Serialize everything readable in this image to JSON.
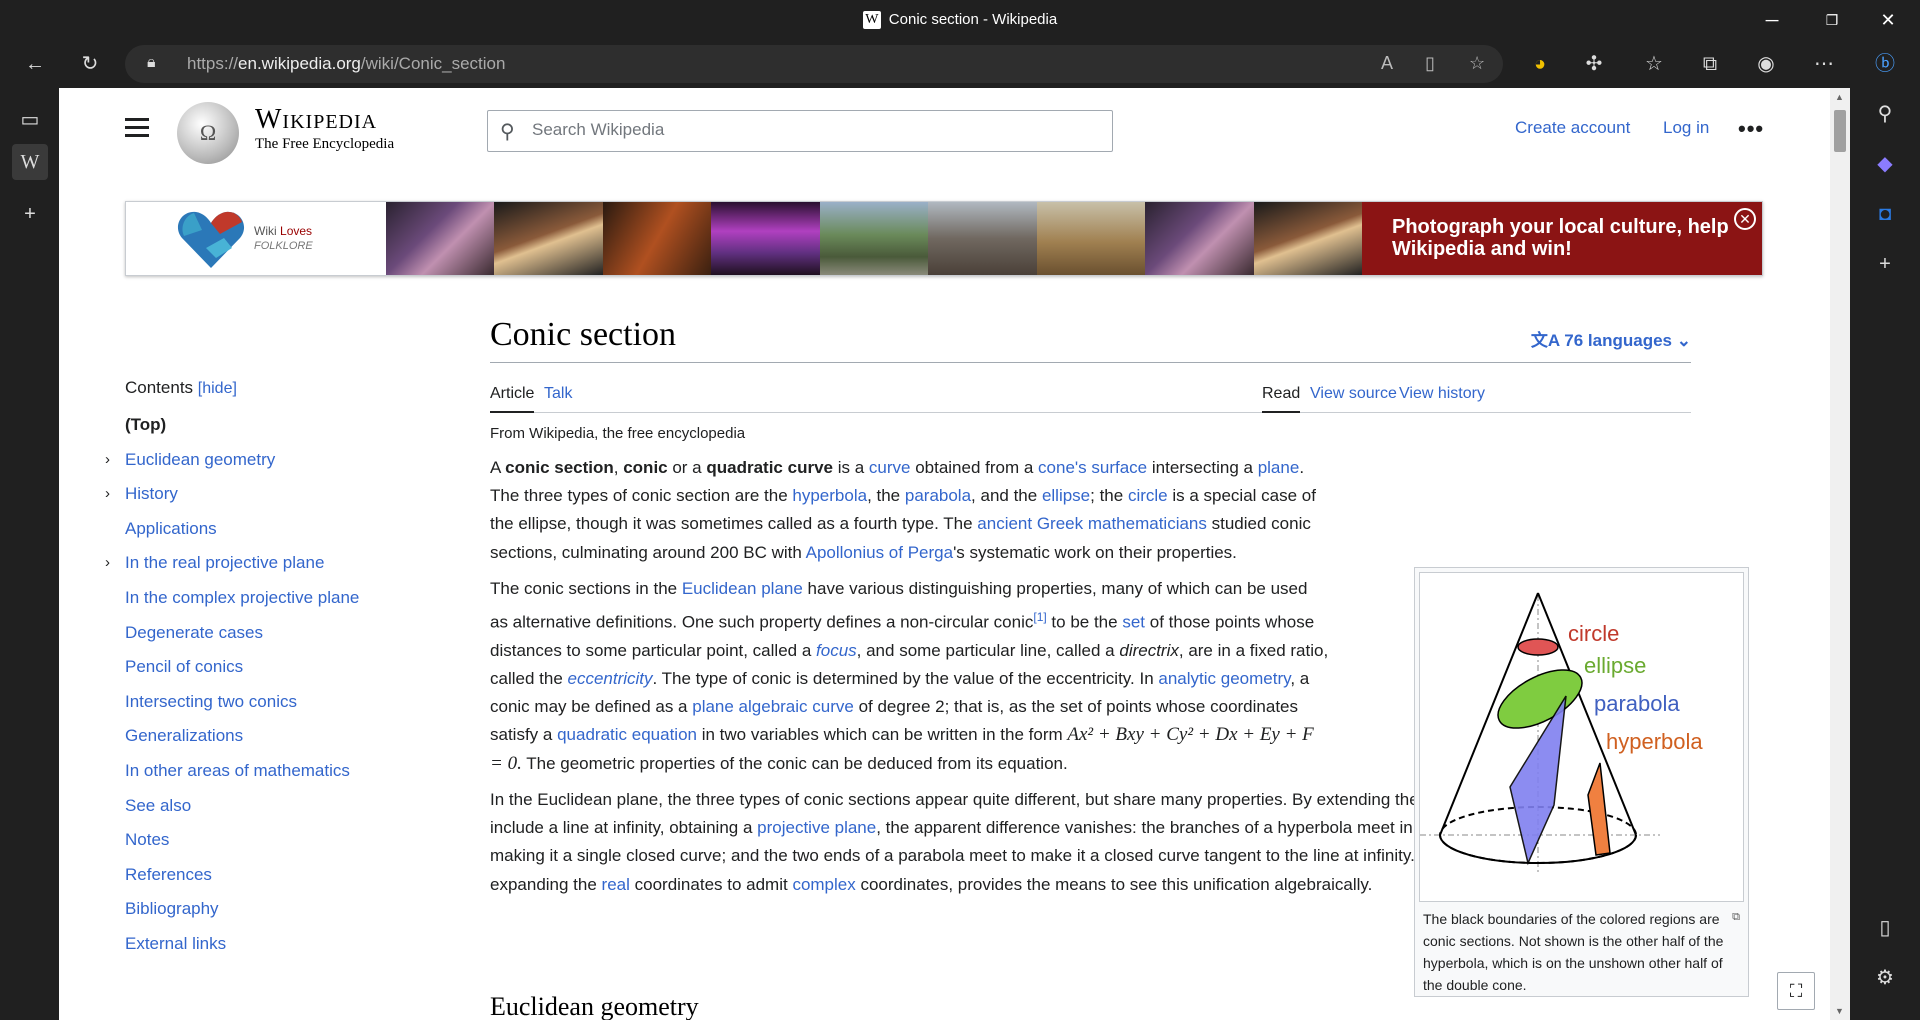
{
  "window": {
    "title": "Conic section - Wikipedia",
    "tab_icon": "W"
  },
  "address": {
    "scheme": "https://",
    "host": "en.wikipedia.org",
    "path": "/wiki/Conic_section"
  },
  "header": {
    "wordmark": "Wikipedia",
    "tagline": "The Free Encyclopedia",
    "search_placeholder": "Search Wikipedia",
    "create_account": "Create account",
    "log_in": "Log in",
    "more": "•••"
  },
  "banner": {
    "logo_text_1": "Wiki",
    "logo_text_2": "Loves",
    "logo_text_3": "FOLKLORE",
    "cta": "Photograph your local culture, help Wikipedia and win!",
    "close": "✕"
  },
  "toc": {
    "title": "Contents",
    "hide": "[hide]",
    "items": [
      {
        "label": "(Top)",
        "chevron": false
      },
      {
        "label": "Euclidean geometry",
        "chevron": true
      },
      {
        "label": "History",
        "chevron": true
      },
      {
        "label": "Applications",
        "chevron": false
      },
      {
        "label": "In the real projective plane",
        "chevron": true
      },
      {
        "label": "In the complex projective plane",
        "chevron": false
      },
      {
        "label": "Degenerate cases",
        "chevron": false
      },
      {
        "label": "Pencil of conics",
        "chevron": false
      },
      {
        "label": "Intersecting two conics",
        "chevron": false
      },
      {
        "label": "Generalizations",
        "chevron": false
      },
      {
        "label": "In other areas of mathematics",
        "chevron": false
      },
      {
        "label": "See also",
        "chevron": false
      },
      {
        "label": "Notes",
        "chevron": false
      },
      {
        "label": "References",
        "chevron": false
      },
      {
        "label": "Bibliography",
        "chevron": false
      },
      {
        "label": "External links",
        "chevron": false
      }
    ]
  },
  "article": {
    "title": "Conic section",
    "languages": "76 languages",
    "tabs": {
      "article": "Article",
      "talk": "Talk",
      "read": "Read",
      "view_source": "View source",
      "view_history": "View history"
    },
    "from": "From Wikipedia, the free encyclopedia",
    "p1": {
      "t1": "A ",
      "b1": "conic section",
      "t2": ", ",
      "b2": "conic",
      "t3": " or a ",
      "b3": "quadratic curve",
      "t4": " is a ",
      "l1": "curve",
      "t5": " obtained from a ",
      "l2": "cone's surface",
      "t6": " intersecting a ",
      "l3": "plane",
      "t7": ". The three types of conic section are the ",
      "l4": "hyperbola",
      "t8": ", the ",
      "l5": "parabola",
      "t9": ", and the ",
      "l6": "ellipse",
      "t10": "; the ",
      "l7": "circle",
      "t11": " is a special case of the ellipse, though it was sometimes called as a fourth type. The ",
      "l8": "ancient Greek mathematicians",
      "t12": " studied conic sections, culminating around 200 BC with ",
      "l9": "Apollonius of Perga",
      "t13": "'s systematic work on their properties."
    },
    "p2": {
      "t1": "The conic sections in the ",
      "l1": "Euclidean plane",
      "t2": " have various distinguishing properties, many of which can be used as alternative definitions. One such property defines a non-circular conic",
      "ref": "[1]",
      "t3": " to be the ",
      "l2": "set",
      "t4": " of those points whose distances to some particular point, called a ",
      "l3": "focus",
      "t5": ", and some particular line, called a ",
      "i1": "directrix",
      "t6": ", are in a fixed ratio, called the ",
      "l4": "eccentricity",
      "t7": ". The type of conic is determined by the value of the eccentricity. In ",
      "l5": "analytic geometry",
      "t8": ", a conic may be defined as a ",
      "l6": "plane algebraic curve",
      "t9": " of degree 2; that is, as the set of points whose coordinates satisfy a ",
      "l7": "quadratic equation",
      "t10": " in two variables which can be written in the form ",
      "eq": "Ax² + Bxy + Cy² + Dx + Ey + F = 0.",
      "t11": " The geometric properties of the conic can be deduced from its equation."
    },
    "p3": {
      "t1": "In the Euclidean plane, the three types of conic sections appear quite different, but share many properties. By extending the Euclidean plane to include a line at infinity, obtaining a ",
      "l1": "projective plane",
      "t2": ", the apparent difference vanishes: the branches of a hyperbola meet in two points at infinity, making it a single closed curve; and the two ends of a parabola meet to make it a closed curve tangent to the line at infinity. Further extension, by expanding the ",
      "l2": "real",
      "t3": " coordinates to admit ",
      "l3": "complex",
      "t4": " coordinates, provides the means to see this unification algebraically."
    },
    "next_heading": "Euclidean geometry"
  },
  "infobox": {
    "labels": {
      "circle": "circle",
      "ellipse": "ellipse",
      "parabola": "parabola",
      "hyperbola": "hyperbola"
    },
    "caption": "The black boundaries of the colored regions are conic sections. Not shown is the other half of the hyperbola, which is on the unshown other half of the double cone."
  },
  "colors": {
    "link": "#3366cc",
    "banner_cta": "#8b1414",
    "circle": "#e05555",
    "ellipse": "#7fcc40",
    "parabola": "#8080f0",
    "hyperbola": "#f08040"
  }
}
